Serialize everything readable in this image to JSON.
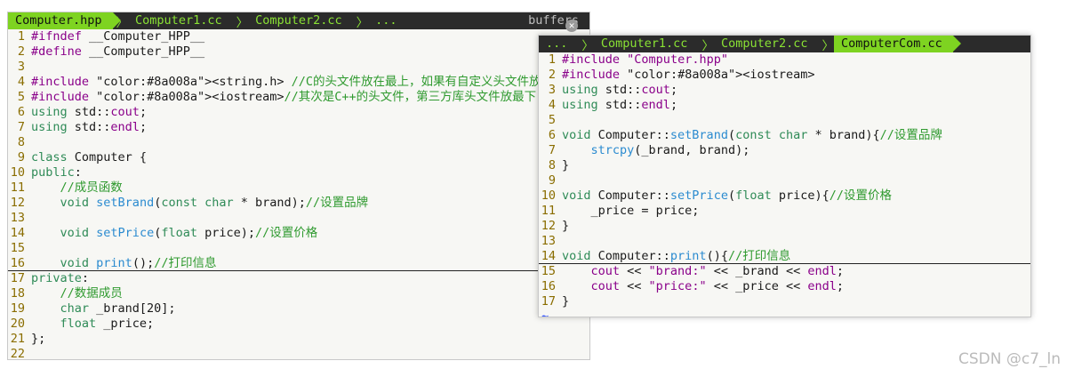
{
  "colors": {
    "comment": "#2f9a2f",
    "keyword": "#8a008a",
    "type": "#2f8b57",
    "string": "#8a008a",
    "func": "#2b8bd0",
    "linenum": "#8a6d00",
    "tab_active": "#7ed321",
    "tabbar_bg": "#2b2b2b"
  },
  "left": {
    "tabs": [
      {
        "label": "Computer.hpp",
        "active": true
      },
      {
        "label": "Computer1.cc",
        "active": false
      },
      {
        "label": "Computer2.cc",
        "active": false
      },
      {
        "label": "...",
        "active": false
      }
    ],
    "buffers_label": "buffers",
    "lines": [
      {
        "n": "1",
        "text": "#ifndef __Computer_HPP__"
      },
      {
        "n": "2",
        "text": "#define __Computer_HPP__"
      },
      {
        "n": "3",
        "text": ""
      },
      {
        "n": "4",
        "text": "#include <string.h> //C的头文件放在最上，如果有自定义头文件放在最上"
      },
      {
        "n": "5",
        "text": "#include <iostream>//其次是C++的头文件，第三方库头文件放最下"
      },
      {
        "n": "6",
        "text": "using std::cout;"
      },
      {
        "n": "7",
        "text": "using std::endl;"
      },
      {
        "n": "8",
        "text": ""
      },
      {
        "n": "9",
        "text": "class Computer {"
      },
      {
        "n": "10",
        "text": "public:"
      },
      {
        "n": "11",
        "text": "    //成员函数"
      },
      {
        "n": "12",
        "text": "    void setBrand(const char * brand);//设置品牌"
      },
      {
        "n": "13",
        "text": ""
      },
      {
        "n": "14",
        "text": "    void setPrice(float price);//设置价格"
      },
      {
        "n": "15",
        "text": ""
      },
      {
        "n": "16",
        "text": "    void print();//打印信息"
      },
      {
        "n": "17",
        "text": "private:"
      },
      {
        "n": "18",
        "text": "    //数据成员"
      },
      {
        "n": "19",
        "text": "    char _brand[20];"
      },
      {
        "n": "20",
        "text": "    float _price;"
      },
      {
        "n": "21",
        "text": "};"
      },
      {
        "n": "22",
        "text": ""
      }
    ]
  },
  "right": {
    "tabs": [
      {
        "label": "...",
        "active": false
      },
      {
        "label": "Computer1.cc",
        "active": false
      },
      {
        "label": "Computer2.cc",
        "active": false
      },
      {
        "label": "ComputerCom.cc",
        "active": true
      }
    ],
    "lines": [
      {
        "n": "1",
        "text": "#include \"Computer.hpp\""
      },
      {
        "n": "2",
        "text": "#include <iostream>"
      },
      {
        "n": "3",
        "text": "using std::cout;"
      },
      {
        "n": "4",
        "text": "using std::endl;"
      },
      {
        "n": "5",
        "text": ""
      },
      {
        "n": "6",
        "text": "void Computer::setBrand(const char * brand){//设置品牌"
      },
      {
        "n": "7",
        "text": "    strcpy(_brand, brand);"
      },
      {
        "n": "8",
        "text": "}"
      },
      {
        "n": "9",
        "text": ""
      },
      {
        "n": "10",
        "text": "void Computer::setPrice(float price){//设置价格"
      },
      {
        "n": "11",
        "text": "    _price = price;"
      },
      {
        "n": "12",
        "text": "}"
      },
      {
        "n": "13",
        "text": ""
      },
      {
        "n": "14",
        "text": "void Computer::print(){//打印信息"
      },
      {
        "n": "15",
        "text": "    cout << \"brand:\" << _brand << endl;"
      },
      {
        "n": "16",
        "text": "    cout << \"price:\" << _price << endl;"
      },
      {
        "n": "17",
        "text": "}"
      }
    ],
    "tilde": "~"
  },
  "watermark": "CSDN @c7_ln"
}
